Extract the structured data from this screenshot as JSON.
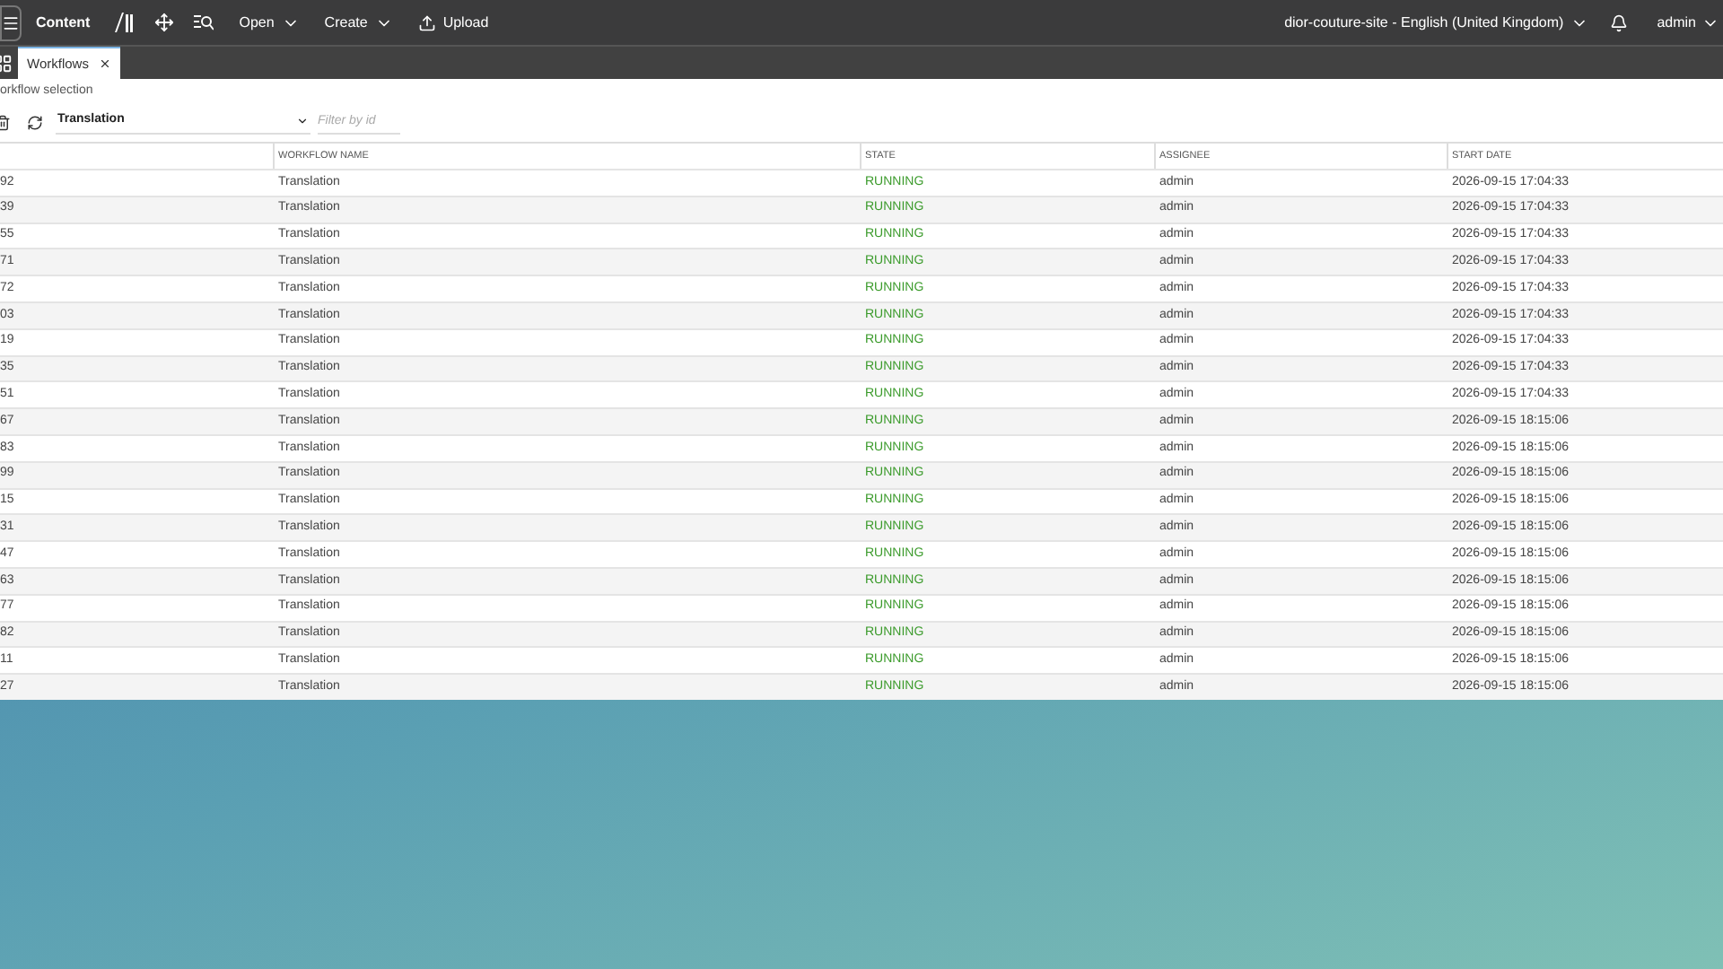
{
  "top_bar": {
    "section": "Content",
    "menus": [
      {
        "label": "Open",
        "kind": "dropdown"
      },
      {
        "label": "Create",
        "kind": "dropdown"
      },
      {
        "label": "Upload",
        "kind": "upload"
      }
    ],
    "site": "dior-couture-site - English (United Kingdom)",
    "user": "admin"
  },
  "tabs": [
    {
      "label": "Workflows",
      "selected": true
    }
  ],
  "panel": {
    "title": "orkflow selection",
    "filter_select": "Translation",
    "filter_placeholder": "Filter by id"
  },
  "table": {
    "columns": [
      "",
      "WORKFLOW NAME",
      "STATE",
      "ASSIGNEE",
      "START DATE"
    ],
    "rows": [
      [
        "92",
        "Translation",
        "RUNNING",
        "admin",
        "2026-09-15 17:04:33"
      ],
      [
        "39",
        "Translation",
        "RUNNING",
        "admin",
        "2026-09-15 17:04:33"
      ],
      [
        "55",
        "Translation",
        "RUNNING",
        "admin",
        "2026-09-15 17:04:33"
      ],
      [
        "71",
        "Translation",
        "RUNNING",
        "admin",
        "2026-09-15 17:04:33"
      ],
      [
        "72",
        "Translation",
        "RUNNING",
        "admin",
        "2026-09-15 17:04:33"
      ],
      [
        "03",
        "Translation",
        "RUNNING",
        "admin",
        "2026-09-15 17:04:33"
      ],
      [
        "19",
        "Translation",
        "RUNNING",
        "admin",
        "2026-09-15 17:04:33"
      ],
      [
        "35",
        "Translation",
        "RUNNING",
        "admin",
        "2026-09-15 17:04:33"
      ],
      [
        "51",
        "Translation",
        "RUNNING",
        "admin",
        "2026-09-15 17:04:33"
      ],
      [
        "67",
        "Translation",
        "RUNNING",
        "admin",
        "2026-09-15 18:15:06"
      ],
      [
        "83",
        "Translation",
        "RUNNING",
        "admin",
        "2026-09-15 18:15:06"
      ],
      [
        "99",
        "Translation",
        "RUNNING",
        "admin",
        "2026-09-15 18:15:06"
      ],
      [
        "15",
        "Translation",
        "RUNNING",
        "admin",
        "2026-09-15 18:15:06"
      ],
      [
        "31",
        "Translation",
        "RUNNING",
        "admin",
        "2026-09-15 18:15:06"
      ],
      [
        "47",
        "Translation",
        "RUNNING",
        "admin",
        "2026-09-15 18:15:06"
      ],
      [
        "63",
        "Translation",
        "RUNNING",
        "admin",
        "2026-09-15 18:15:06"
      ],
      [
        "77",
        "Translation",
        "RUNNING",
        "admin",
        "2026-09-15 18:15:06"
      ],
      [
        "82",
        "Translation",
        "RUNNING",
        "admin",
        "2026-09-15 18:15:06"
      ],
      [
        "11",
        "Translation",
        "RUNNING",
        "admin",
        "2026-09-15 18:15:06"
      ],
      [
        "27",
        "Translation",
        "RUNNING",
        "admin",
        "2026-09-15 18:15:06"
      ]
    ]
  }
}
